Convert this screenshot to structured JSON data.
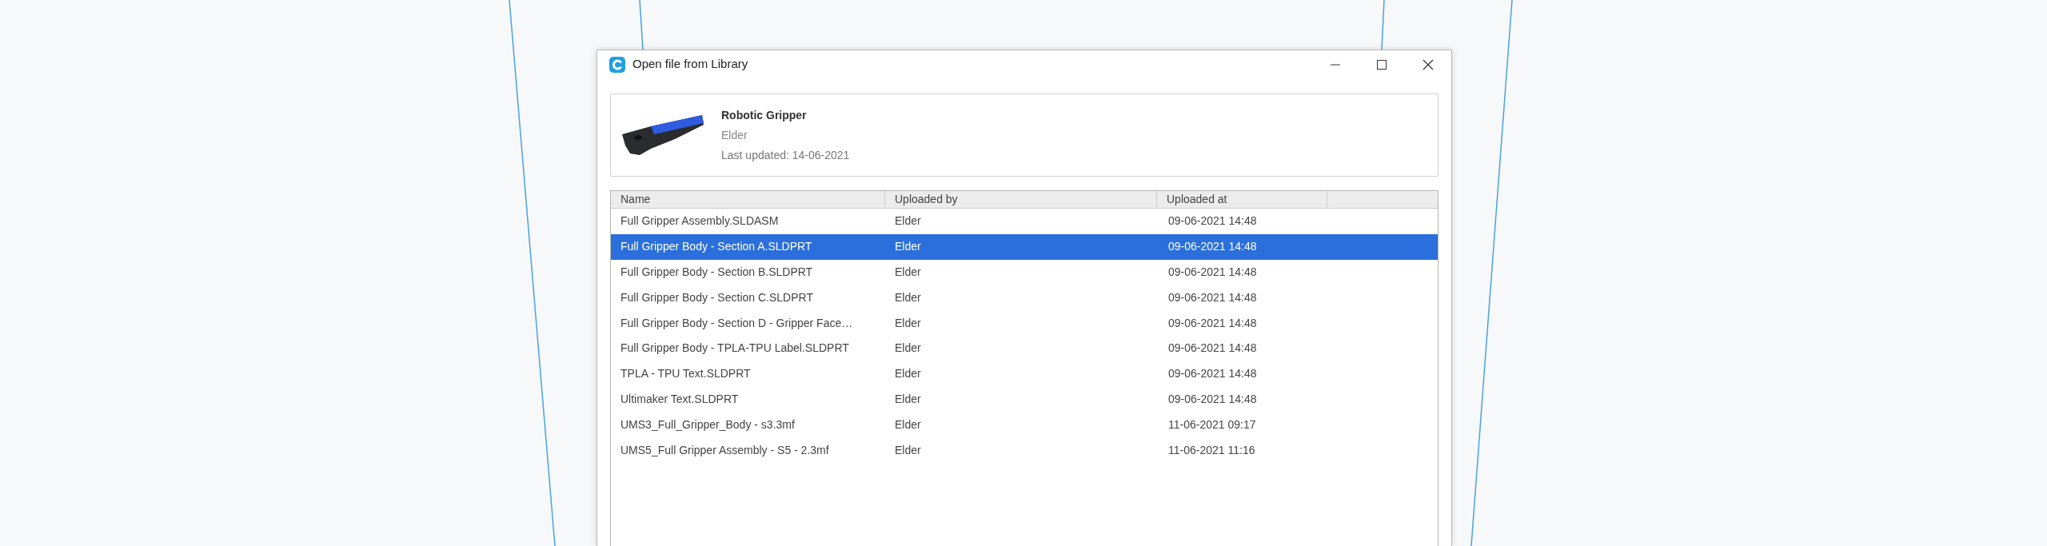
{
  "window": {
    "title": "Open file from Library"
  },
  "project": {
    "title": "Robotic Gripper",
    "owner": "Elder",
    "last_updated": "Last updated: 14-06-2021"
  },
  "table": {
    "columns": [
      "Name",
      "Uploaded by",
      "Uploaded at"
    ],
    "rows": [
      {
        "name": "Full Gripper Assembly.SLDASM",
        "uploaded_by": "Elder",
        "uploaded_at": "09-06-2021 14:48",
        "selected": false
      },
      {
        "name": "Full Gripper Body - Section A.SLDPRT",
        "uploaded_by": "Elder",
        "uploaded_at": "09-06-2021 14:48",
        "selected": true
      },
      {
        "name": "Full Gripper Body - Section B.SLDPRT",
        "uploaded_by": "Elder",
        "uploaded_at": "09-06-2021 14:48",
        "selected": false
      },
      {
        "name": "Full Gripper Body - Section C.SLDPRT",
        "uploaded_by": "Elder",
        "uploaded_at": "09-06-2021 14:48",
        "selected": false
      },
      {
        "name": "Full Gripper Body - Section D - Gripper Face…",
        "uploaded_by": "Elder",
        "uploaded_at": "09-06-2021 14:48",
        "selected": false
      },
      {
        "name": "Full Gripper Body - TPLA-TPU Label.SLDPRT",
        "uploaded_by": "Elder",
        "uploaded_at": "09-06-2021 14:48",
        "selected": false
      },
      {
        "name": "TPLA - TPU Text.SLDPRT",
        "uploaded_by": "Elder",
        "uploaded_at": "09-06-2021 14:48",
        "selected": false
      },
      {
        "name": "Ultimaker Text.SLDPRT",
        "uploaded_by": "Elder",
        "uploaded_at": "09-06-2021 14:48",
        "selected": false
      },
      {
        "name": "UMS3_Full_Gripper_Body - s3.3mf",
        "uploaded_by": "Elder",
        "uploaded_at": "11-06-2021 09:17",
        "selected": false
      },
      {
        "name": "UMS5_Full Gripper Assembly - S5 - 2.3mf",
        "uploaded_by": "Elder",
        "uploaded_at": "11-06-2021 11:16",
        "selected": false
      }
    ]
  }
}
